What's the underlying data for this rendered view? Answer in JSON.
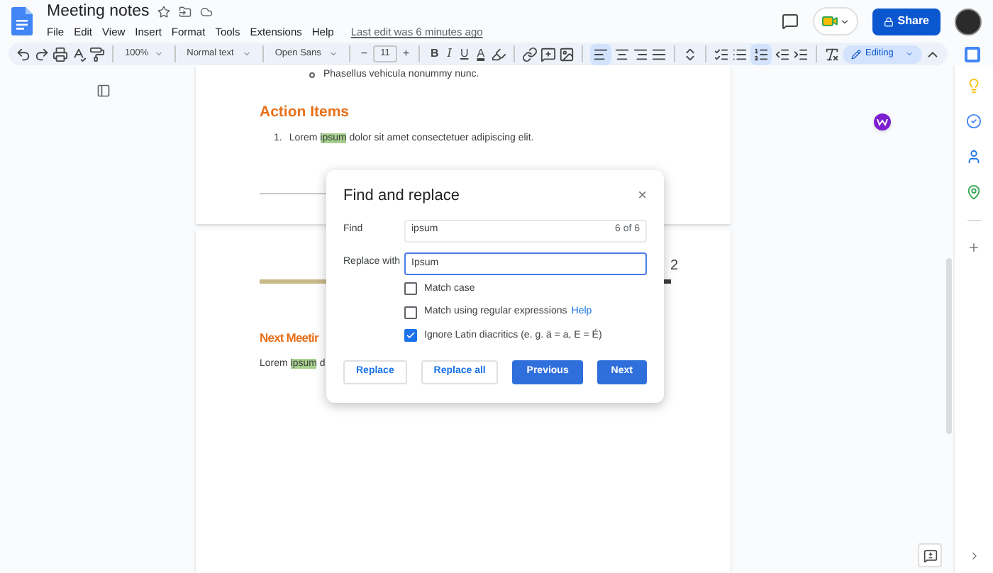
{
  "document": {
    "title": "Meeting notes",
    "last_edit": "Last edit was 6 minutes ago"
  },
  "menu": [
    "File",
    "Edit",
    "View",
    "Insert",
    "Format",
    "Tools",
    "Extensions",
    "Help"
  ],
  "share_button": "Share",
  "toolbar": {
    "zoom": "100%",
    "style": "Normal text",
    "font": "Open Sans",
    "minus": "−",
    "size": "11",
    "plus": "+",
    "format_letters": [
      "B",
      "I",
      "U",
      "A"
    ],
    "alignment": [
      {
        "selected": true
      },
      {
        "selected": false
      },
      {
        "selected": false
      },
      {
        "selected": false
      }
    ],
    "lists": [
      {
        "selected": false
      },
      {
        "selected": false
      },
      {
        "selected": true
      }
    ],
    "mode": "Editing"
  },
  "page_1": {
    "bullet": "Phasellus vehicula nonummy nunc.",
    "heading": "Action Items",
    "item_number": "1.",
    "item": [
      {
        "text": "Lorem ",
        "highlighted": false
      },
      {
        "text": "ipsum",
        "highlighted": true
      },
      {
        "text": " dolor sit amet consectetuer adipiscing elit.",
        "highlighted": false
      }
    ]
  },
  "page_2": {
    "corner_text": "2",
    "heading": "Next Meetir",
    "line": [
      {
        "text": "Lorem ",
        "highlighted": false
      },
      {
        "text": "ipsum",
        "highlighted": true
      },
      {
        "text": " d",
        "highlighted": false
      }
    ]
  },
  "dialog": {
    "title": "Find and replace",
    "close": "×",
    "find": {
      "label": "Find",
      "value": "ipsum",
      "count": "6 of 6"
    },
    "replace": {
      "label": "Replace with",
      "value": "Ipsum",
      "focused": true
    },
    "options": [
      {
        "label": "Match case",
        "checked": false
      },
      {
        "label": "Match using regular expressions",
        "link": "Help",
        "checked": false
      },
      {
        "label": "Ignore Latin diacritics (e. g. ä = a, E = É)",
        "checked": true
      }
    ],
    "buttons": [
      {
        "label": "Replace",
        "kind": "outlined"
      },
      {
        "label": "Replace all",
        "kind": "outlined"
      },
      {
        "label": "Previous",
        "kind": "filled"
      },
      {
        "label": "Next",
        "kind": "filled"
      }
    ]
  }
}
